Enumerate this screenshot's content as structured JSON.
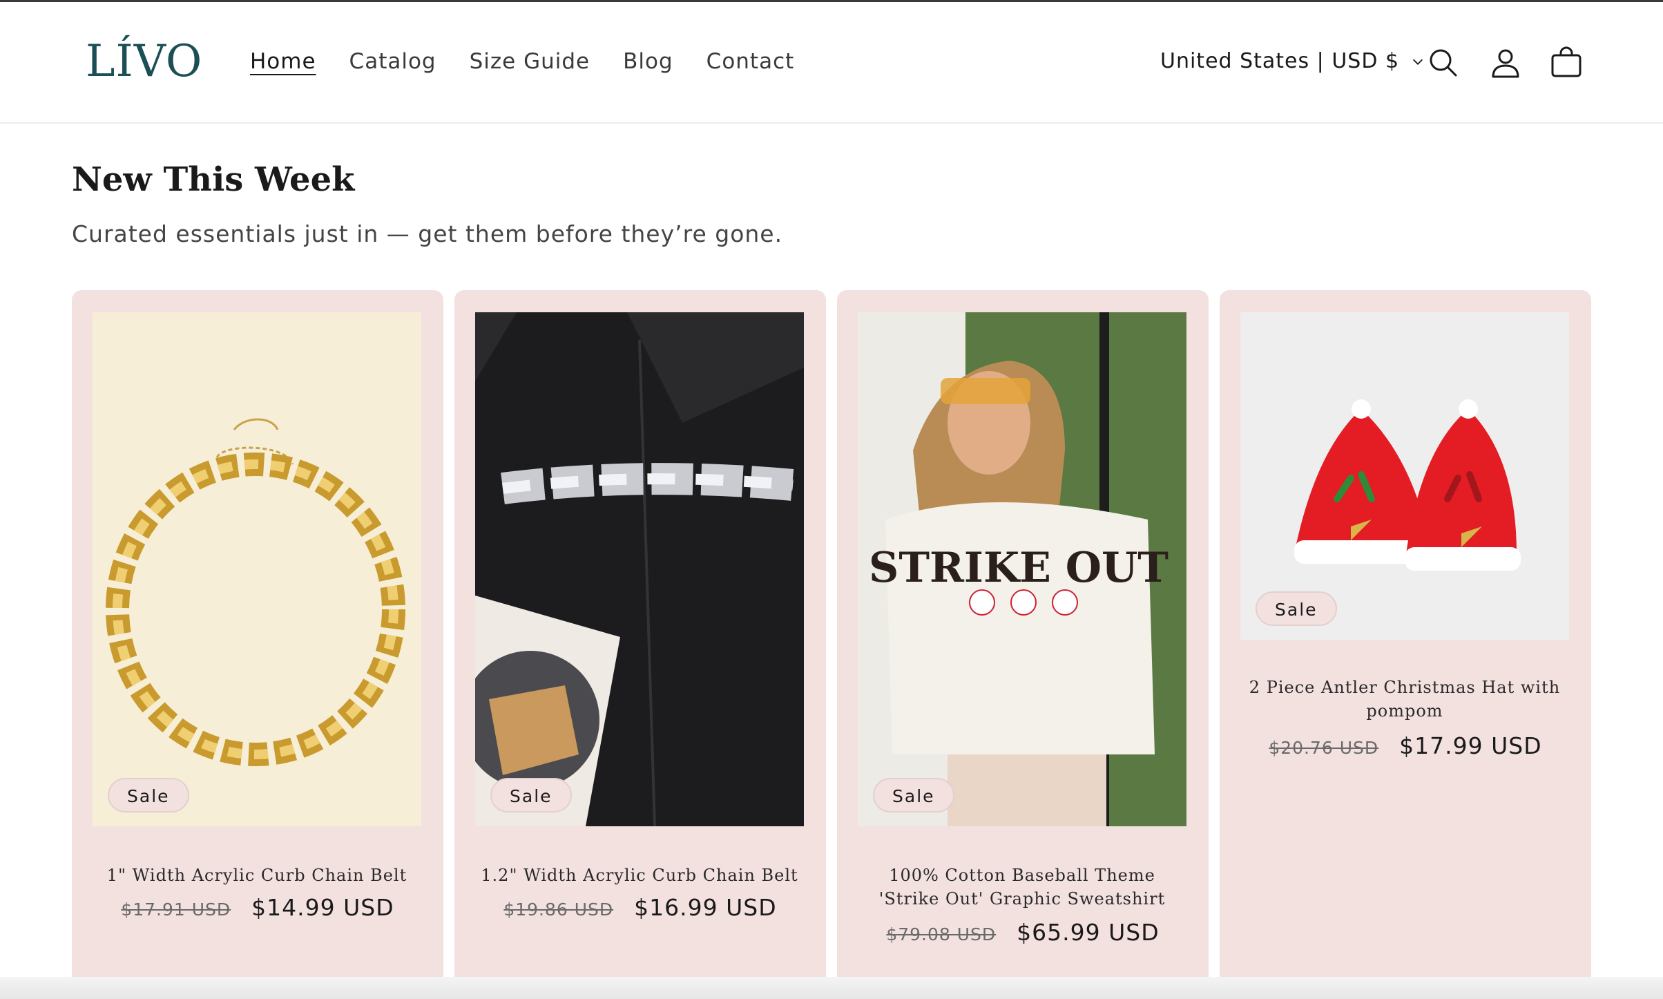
{
  "brand": {
    "logo_text": "LÍVO"
  },
  "nav": {
    "items": [
      {
        "label": "Home",
        "active": true
      },
      {
        "label": "Catalog"
      },
      {
        "label": "Size Guide"
      },
      {
        "label": "Blog"
      },
      {
        "label": "Contact"
      }
    ]
  },
  "header": {
    "locale": "United States | USD $",
    "icons": [
      "search-icon",
      "account-icon",
      "cart-icon"
    ]
  },
  "section": {
    "title": "New This Week",
    "subtitle": "Curated essentials just in — get them before they’re gone."
  },
  "products": [
    {
      "name": "1\" Width Acrylic Curb Chain Belt",
      "old_price": "$17.91 USD",
      "price": "$14.99 USD",
      "badge": "Sale"
    },
    {
      "name": "1.2\" Width Acrylic Curb Chain Belt",
      "old_price": "$19.86 USD",
      "price": "$16.99 USD",
      "badge": "Sale"
    },
    {
      "name": "100% Cotton Baseball Theme 'Strike Out' Graphic Sweatshirt",
      "old_price": "$79.08 USD",
      "price": "$65.99 USD",
      "badge": "Sale",
      "graphic_text": "STRIKE OUT"
    },
    {
      "name": "2 Piece Antler Christmas Hat with pompom",
      "old_price": "$20.76 USD",
      "price": "$17.99 USD",
      "badge": "Sale"
    }
  ],
  "colors": {
    "card_bg": "#f3e1e0",
    "logo": "#1c4f55",
    "text": "#1a1a1a"
  }
}
